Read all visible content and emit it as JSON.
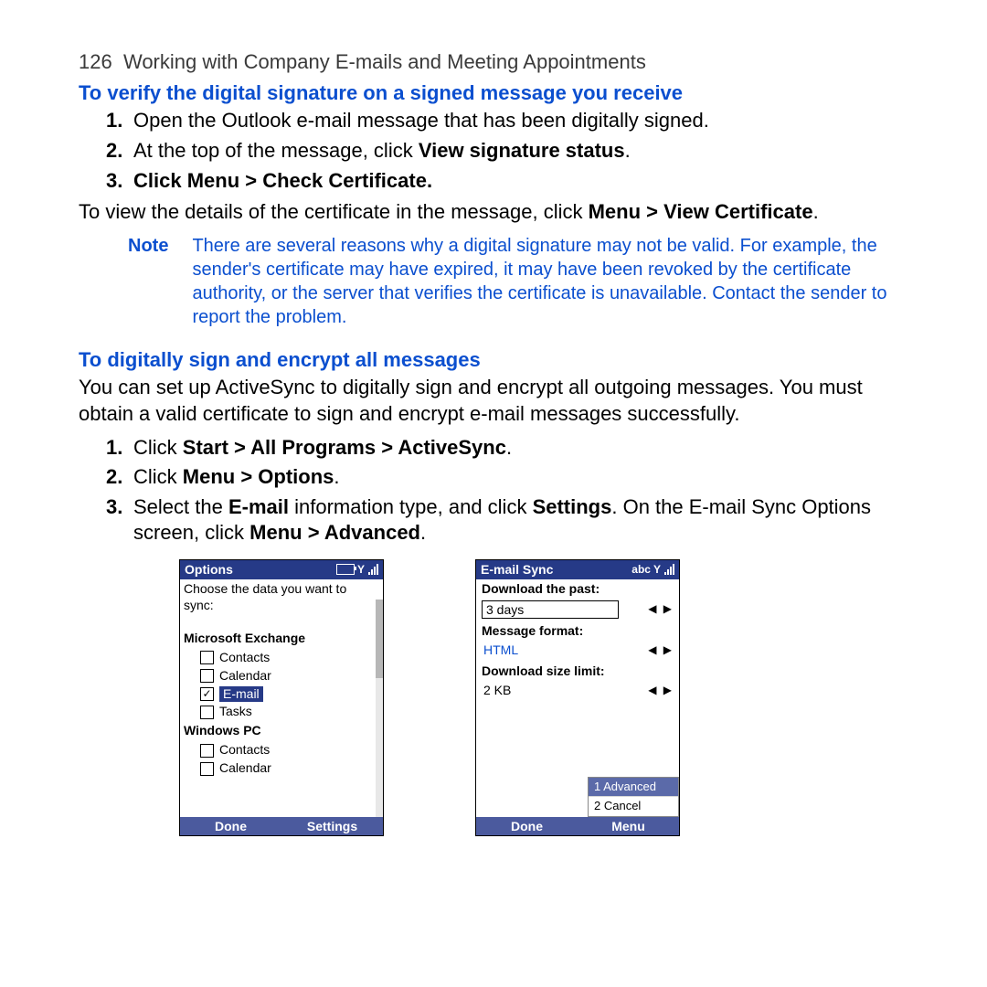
{
  "page_number": "126",
  "header_text": "Working with Company E-mails and Meeting Appointments",
  "section1_title": "To verify the digital signature on a signed message you receive",
  "steps1": [
    "Open the Outlook e-mail message that has been digitally signed.",
    "At the top of the message, click <b>View signature status</b>.",
    "Click <b>Menu > Check Certificate</b>."
  ],
  "para_after_steps1": "To view the details of the certificate in the message, click <b>Menu > View Certificate</b>.",
  "note_label": "Note",
  "note_text": "There are several reasons why a digital signature may not be valid. For example, the sender's certificate may have expired, it may have been revoked by the certificate authority, or the server that verifies the certificate is unavailable. Contact the sender to report the problem.",
  "section2_title": "To digitally sign and encrypt all messages",
  "para2": "You can set up ActiveSync to digitally sign and encrypt all outgoing messages. You must obtain a valid certificate to sign and encrypt e-mail messages successfully.",
  "steps2": [
    "Click <b>Start > All Programs > ActiveSync</b>.",
    "Click <b>Menu > Options</b>.",
    "Select the <b>E-mail</b> information type, and click <b>Settings</b>. On the E-mail Sync Options screen, click <b>Menu > Advanced</b>."
  ],
  "phone1": {
    "title": "Options",
    "subhead": "Choose the data you want to sync:",
    "group1": "Microsoft Exchange",
    "g1_items": [
      {
        "label": "Contacts",
        "checked": false,
        "selected": false
      },
      {
        "label": "Calendar",
        "checked": false,
        "selected": false
      },
      {
        "label": "E-mail",
        "checked": true,
        "selected": true
      },
      {
        "label": "Tasks",
        "checked": false,
        "selected": false
      }
    ],
    "group2": "Windows PC",
    "g2_items": [
      {
        "label": "Contacts",
        "checked": false
      },
      {
        "label": "Calendar",
        "checked": false
      }
    ],
    "foot_left": "Done",
    "foot_right": "Settings"
  },
  "phone2": {
    "title": "E-mail Sync",
    "title_right": "abc",
    "f1_label": "Download the past:",
    "f1_value": "3 days",
    "f2_label": "Message format:",
    "f2_value": "HTML",
    "f3_label": "Download size limit:",
    "f3_value": "2 KB",
    "menu": {
      "item1": "1 Advanced",
      "item2": "2 Cancel"
    },
    "foot_left": "Done",
    "foot_right": "Menu"
  }
}
